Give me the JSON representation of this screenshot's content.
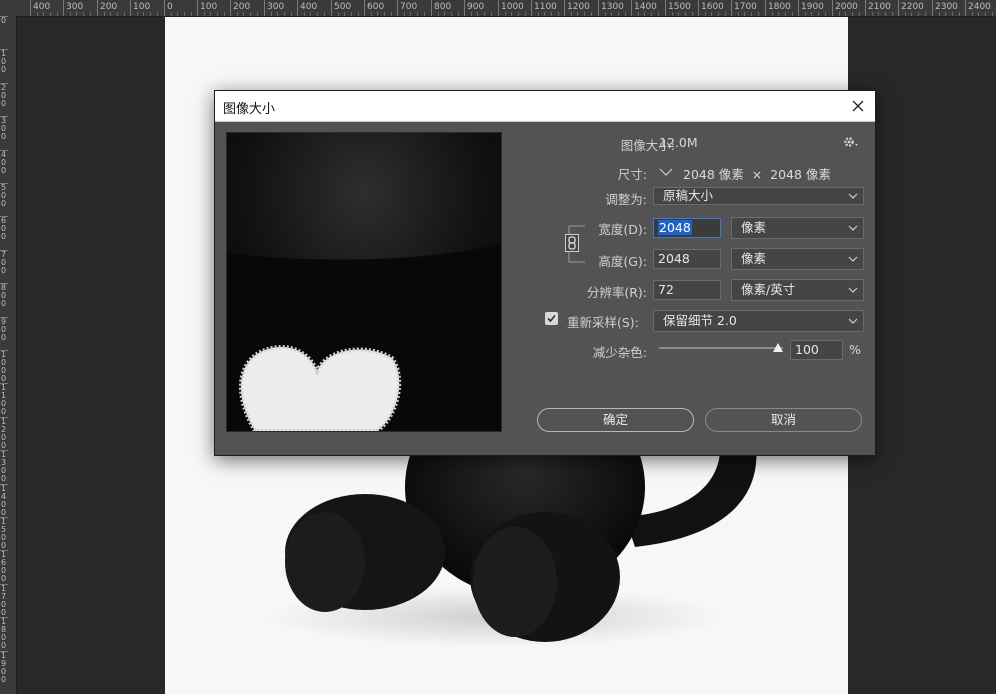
{
  "ruler": {
    "top_labels": [
      "400",
      "300",
      "200",
      "100",
      "0",
      "100",
      "200",
      "300",
      "400",
      "500",
      "600",
      "700",
      "800",
      "900",
      "1000",
      "1100",
      "1200",
      "1300",
      "1400",
      "1500",
      "1600",
      "1700",
      "1800",
      "1900",
      "2000",
      "2100",
      "2200",
      "2300",
      "2400"
    ],
    "left_labels": [
      "0",
      "100",
      "200",
      "300",
      "400",
      "500",
      "600",
      "700",
      "800",
      "900",
      "1000",
      "1100",
      "1200",
      "1300",
      "1400",
      "1500",
      "1600",
      "1700",
      "1800",
      "1900"
    ]
  },
  "dialog": {
    "title": "图像大小",
    "image_size_label": "图像大小:",
    "image_size_value": "12.0M",
    "dimensions_label": "尺寸:",
    "dimensions_value": "2048 像素  ×  2048 像素",
    "fit_to_label": "调整为:",
    "fit_to_value": "原稿大小",
    "width_label": "宽度(D):",
    "width_value": "2048",
    "width_unit": "像素",
    "height_label": "高度(G):",
    "height_value": "2048",
    "height_unit": "像素",
    "resolution_label": "分辨率(R):",
    "resolution_value": "72",
    "resolution_unit": "像素/英寸",
    "resample_label": "重新采样(S):",
    "resample_checked": true,
    "resample_value": "保留细节 2.0",
    "noise_label": "减少杂色:",
    "noise_value": "100",
    "noise_unit": "%",
    "ok_label": "确定",
    "cancel_label": "取消"
  },
  "colors": {
    "dialog_bg": "#535353",
    "focus": "#3b7bd6"
  }
}
